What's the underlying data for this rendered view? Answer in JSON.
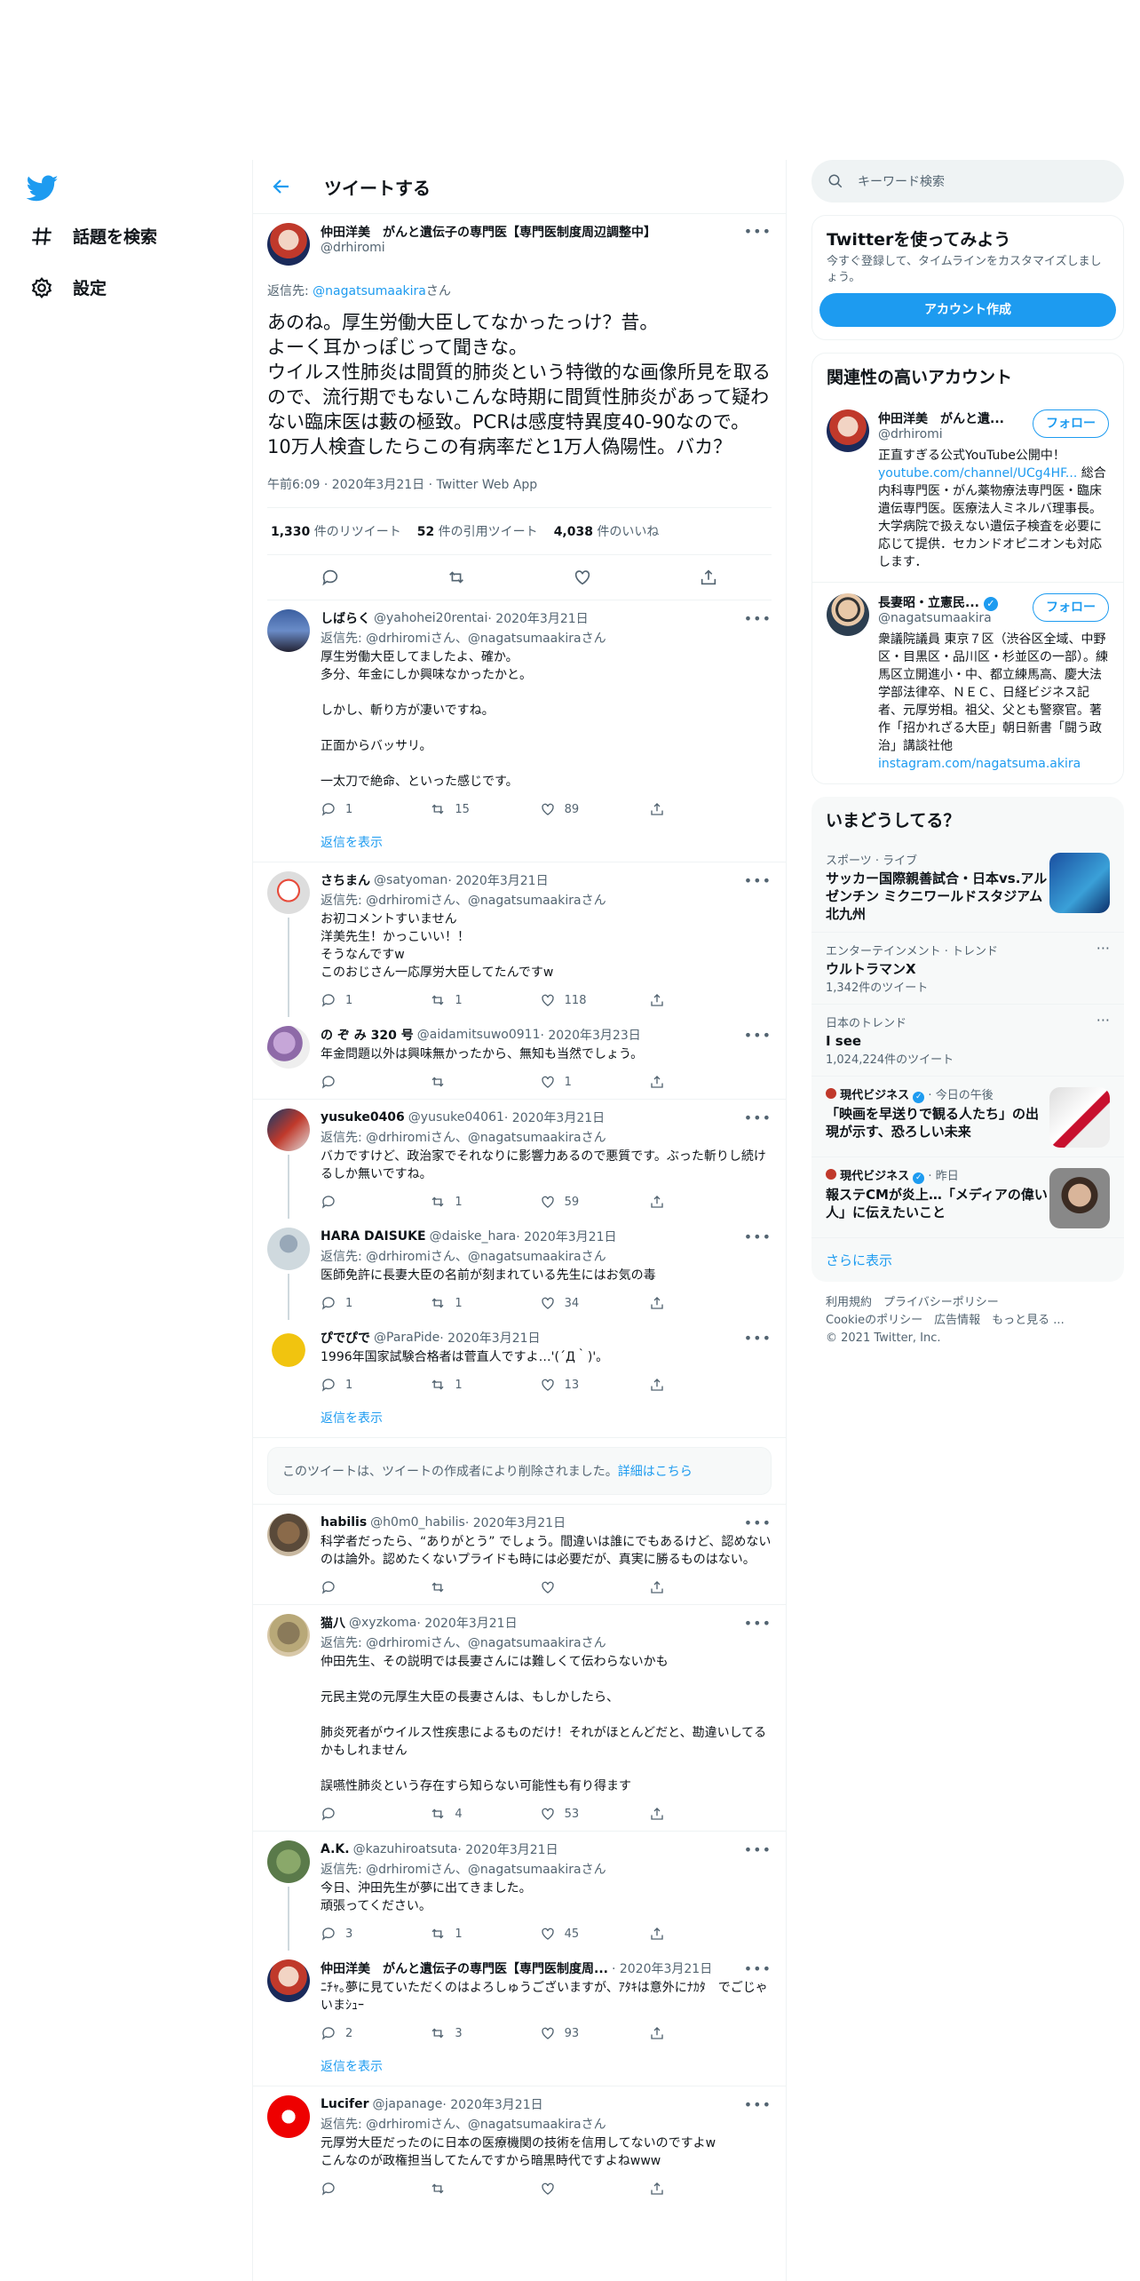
{
  "nav": {
    "explore": "話題を検索",
    "settings": "設定"
  },
  "header": {
    "title": "ツイートする"
  },
  "focal": {
    "name": "仲田洋美　がんと遺伝子の専門医【専門医制度周辺調整中】",
    "handle": "@drhiromi",
    "reply_prefix": "返信先: ",
    "reply_handle": "@nagatsumaakira",
    "reply_suffix": "さん",
    "text": "あのね。厚生労働大臣してなかったっけ？昔。\nよーく耳かっぽじって聞きな。\nウイルス性肺炎は間質的肺炎という特徴的な画像所見を取るので、流行期でもないこんな時期に間質性肺炎があって疑わない臨床医は藪の極致。PCRは感度特異度40-90なので。10万人検査したらこの有病率だと1万人偽陽性。バカ？",
    "meta": "午前6:09 · 2020年3月21日 · Twitter Web App",
    "retweets": "1,330",
    "retweets_label": " 件のリツイート",
    "quotes": "52",
    "quotes_label": " 件の引用ツイート",
    "likes": "4,038",
    "likes_label": " 件のいいね"
  },
  "replies": [
    {
      "name": "しばらく",
      "handle": "@yahohei20rentai",
      "date": " · 2020年3月21日",
      "rt": "返信先: @drhiromiさん、@nagatsumaakiraさん",
      "text": "厚生労働大臣してましたよ、確か。\n多分、年金にしか興味なかったかと。\n\nしかし、斬り方が凄いですね。\n\n正面からバッサリ。\n\n一太刀で絶命、といった感じです。",
      "reply": "1",
      "retweet": "15",
      "like": "89"
    },
    {
      "name": "さちまん",
      "handle": "@satyoman",
      "date": " · 2020年3月21日",
      "rt": "返信先: @drhiromiさん、@nagatsumaakiraさん",
      "text": "お初コメントすいません\n洋美先生！かっこいい！！\nそうなんですw\nこのおじさん一応厚労大臣してたんですw",
      "reply": "1",
      "retweet": "1",
      "like": "118"
    },
    {
      "name": "の ぞ み 320 号",
      "handle": "@aidamitsuwo0911",
      "date": " · 2020年3月23日",
      "rt": "",
      "text": "年金問題以外は興味無かったから、無知も当然でしょう。",
      "reply": "",
      "retweet": "",
      "like": "1"
    },
    {
      "name": "yusuke0406",
      "handle": "@yusuke04061",
      "date": " · 2020年3月21日",
      "rt": "返信先: @drhiromiさん、@nagatsumaakiraさん",
      "text": "バカですけど、政治家でそれなりに影響力あるので悪質です。ぶった斬りし続けるしか無いですね。",
      "reply": "",
      "retweet": "1",
      "like": "59"
    },
    {
      "name": "HARA DAISUKE",
      "handle": "@daiske_hara",
      "date": " · 2020年3月21日",
      "rt": "返信先: @drhiromiさん、@nagatsumaakiraさん",
      "text": "医師免許に長妻大臣の名前が刻まれている先生にはお気の毒",
      "reply": "1",
      "retweet": "1",
      "like": "34"
    },
    {
      "name": "ぴでぴで",
      "handle": "@ParaPide",
      "date": " · 2020年3月21日",
      "rt": "",
      "text": "1996年国家試験合格者は菅直人ですよ…'(´Д｀)'。",
      "reply": "1",
      "retweet": "1",
      "like": "13"
    },
    {
      "name": "habilis",
      "handle": "@h0m0_habilis",
      "date": " · 2020年3月21日",
      "rt": "",
      "text": "科学者だったら、“ありがとう” でしょう。間違いは誰にでもあるけど、認めないのは論外。認めたくないプライドも時には必要だが、真実に勝るものはない。",
      "reply": "",
      "retweet": "",
      "like": ""
    },
    {
      "name": "猫八",
      "handle": "@xyzkoma",
      "date": " · 2020年3月21日",
      "rt": "返信先: @drhiromiさん、@nagatsumaakiraさん",
      "text": "仲田先生、その説明では長妻さんには難しくて伝わらないかも\n\n元民主党の元厚生大臣の長妻さんは、もしかしたら、\n\n肺炎死者がウイルス性疾患によるものだけ！それがほとんどだと、勘違いしてるかもしれません\n\n誤嚥性肺炎という存在すら知らない可能性も有り得ます",
      "reply": "",
      "retweet": "4",
      "like": "53"
    },
    {
      "name": "A.K.",
      "handle": "@kazuhiroatsuta",
      "date": " · 2020年3月21日",
      "rt": "返信先: @drhiromiさん、@nagatsumaakiraさん",
      "text": "今日、沖田先生が夢に出てきました。\n頑張ってください。",
      "reply": "3",
      "retweet": "1",
      "like": "45"
    },
    {
      "name": "仲田洋美　がんと遺伝子の専門医【専門医制度周...",
      "handle": "",
      "date": " · 2020年3月21日",
      "rt": "",
      "text": "ﾆﾁｬ｡夢に見ていただくのはよろしゅうございますが、ｱﾀｷは意外にﾅｶﾀ　でごじゃいまｼｭｰ",
      "reply": "2",
      "retweet": "3",
      "like": "93"
    },
    {
      "name": "Lucifer",
      "handle": "@japanage",
      "date": " · 2020年3月21日",
      "rt": "返信先: @drhiromiさん、@nagatsumaakiraさん",
      "text": "元厚労大臣だったのに日本の医療機関の技術を信用してないのですよw\nこんなのが政権担当してたんですから暗黒時代ですよねwww",
      "reply": "",
      "retweet": "",
      "like": ""
    }
  ],
  "show_replies": "返信を表示",
  "deleted": {
    "text": "このツイートは、ツイートの作成者により削除されました。",
    "link": "詳細はこちら"
  },
  "right": {
    "search_placeholder": "キーワード検索",
    "signup": {
      "title": "Twitterを使ってみよう",
      "sub": "今すぐ登録して、タイムラインをカスタマイズしましょう。",
      "button": "アカウント作成"
    },
    "related": {
      "title": "関連性の高いアカウント",
      "follow": "フォロー",
      "accounts": [
        {
          "name": "仲田洋美　がんと遺...",
          "handle": "@drhiromi",
          "bio_1": "正直すぎる公式YouTube公開中！",
          "bio_link": "youtube.com/channel/UCg4HF...",
          "bio_2": "総合内科専門医・がん薬物療法専門医・臨床遺伝専門医。医療法人ミネルバ理事長。大学病院で扱えない遺伝子検査を必要に応じて提供．セカンドオピニオンも対応します．"
        },
        {
          "name": "長妻昭・立憲民...",
          "handle": "@nagatsumaakira",
          "bio_1": "衆議院議員 東京７区（渋谷区全域、中野区・目黒区・品川区・杉並区の一部）。練馬区立開進小・中、都立練馬高、慶大法学部法律卒、ＮＥＣ、日経ビジネス記者、元厚労相。祖父、父とも警察官。著作「招かれざる大臣」朝日新書「闘う政治」講談社他",
          "bio_link": "instagram.com/nagatsuma.akira",
          "bio_2": ""
        }
      ]
    },
    "trends": {
      "title": "いまどうしてる？",
      "items": [
        {
          "meta": "スポーツ · ライブ",
          "title": "サッカー国際親善試合・日本vs.アルゼンチン ミクニワールドスタジアム北九州",
          "sub": ""
        },
        {
          "meta": "エンターテインメント · トレンド",
          "title": "ウルトラマンX",
          "sub": "1,342件のツイート"
        },
        {
          "meta": "日本のトレンド",
          "title": "I see",
          "sub": "1,024,224件のツイート"
        },
        {
          "meta_name": "現代ビジネス",
          "meta": " · 今日の午後",
          "title": "「映画を早送りで観る人たち」の出現が示す、恐ろしい未来",
          "sub": ""
        },
        {
          "meta_name": "現代ビジネス",
          "meta": " · 昨日",
          "title": "報ステCMが炎上…「メディアの偉い人」に伝えたいこと",
          "sub": ""
        }
      ],
      "more": "さらに表示"
    },
    "footer": {
      "l1a": "利用規約",
      "l1b": "プライバシーポリシー",
      "l2a": "Cookieのポリシー",
      "l2b": "広告情報",
      "l2c": "もっと見る ...",
      "copy": "© 2021 Twitter, Inc."
    }
  },
  "colors": {
    "accent": "#1d9bf0",
    "text": "#0f1419",
    "muted": "#536471",
    "border": "#eff3f4"
  }
}
